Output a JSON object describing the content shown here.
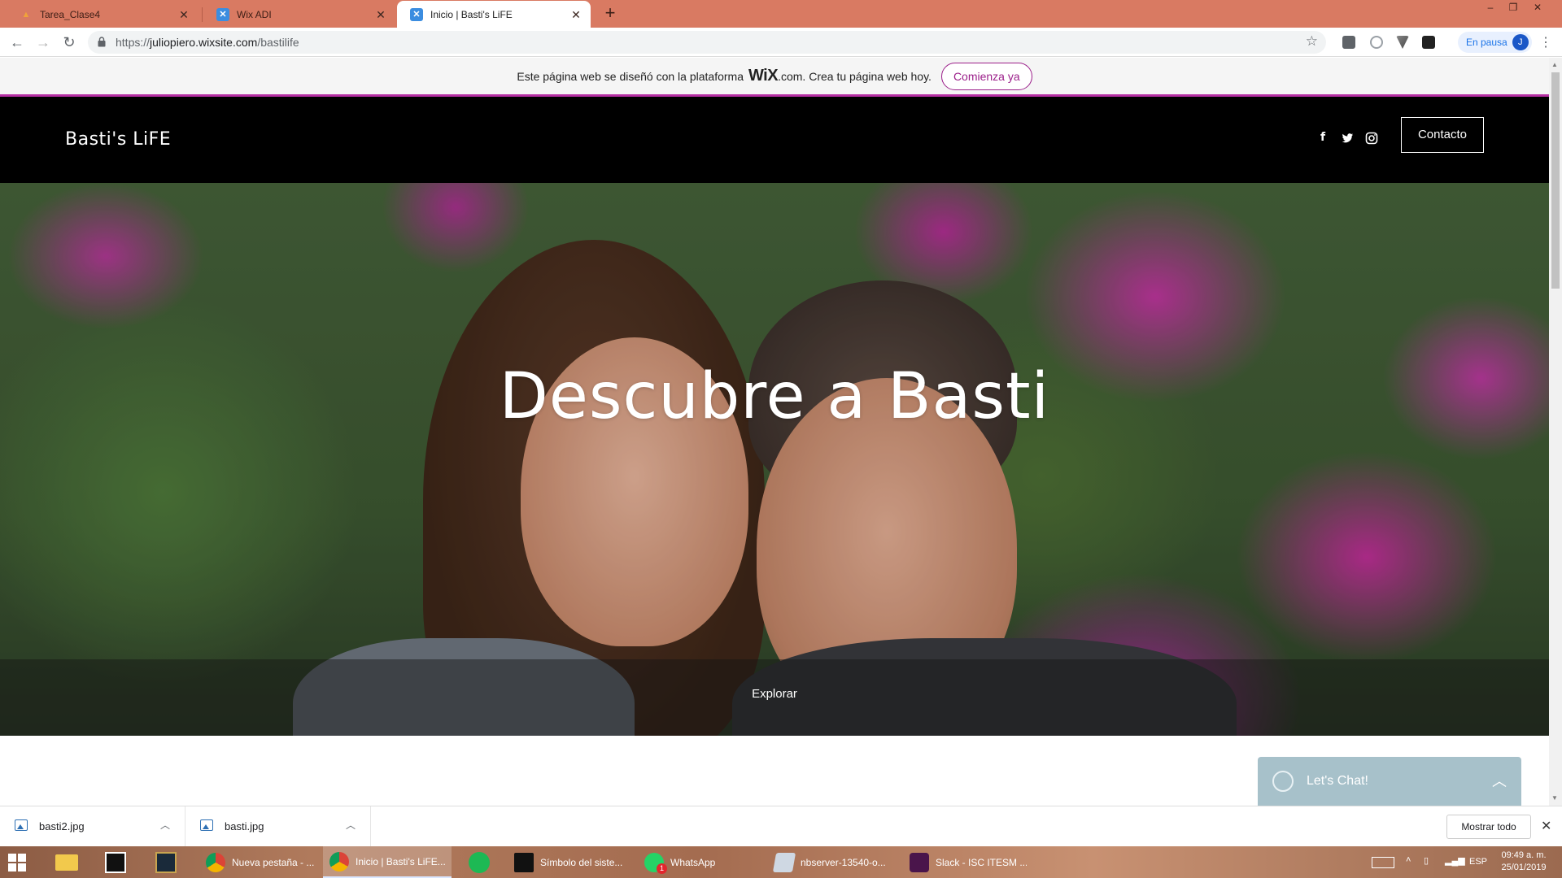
{
  "browser": {
    "tabs": [
      {
        "title": "Tarea_Clase4",
        "active": false
      },
      {
        "title": "Wix ADI",
        "active": false
      },
      {
        "title": "Inicio | Basti's LiFE",
        "active": true
      }
    ],
    "url_prefix": "https://",
    "url_host": "juliopiero.wixsite.com",
    "url_path": "/bastilife",
    "profile_label": "En pausa",
    "profile_initial": "J"
  },
  "wix_banner": {
    "text_before": "Este página web se diseñó con la plataforma",
    "logo": "WiX",
    "text_after": ".com. Crea tu página web hoy.",
    "cta": "Comienza ya"
  },
  "site": {
    "brand": "Basti's LiFE",
    "contact_button": "Contacto",
    "hero_title": "Descubre a Basti",
    "explore_label": "Explorar",
    "accent_color": "#b62fa3"
  },
  "chat": {
    "label": "Let's Chat!"
  },
  "downloads": {
    "items": [
      {
        "name": "basti2.jpg"
      },
      {
        "name": "basti.jpg"
      }
    ],
    "show_all": "Mostrar todo"
  },
  "taskbar": {
    "buttons": [
      {
        "label": "Nueva pestaña - ..."
      },
      {
        "label": "Inicio | Basti's LiFE..."
      },
      {
        "label": "Símbolo del siste..."
      },
      {
        "label": "WhatsApp"
      },
      {
        "label": "nbserver-13540-o..."
      },
      {
        "label": "Slack - ISC ITESM ..."
      }
    ],
    "language": "ESP",
    "time": "09:49 a. m.",
    "date": "25/01/2019",
    "whatsapp_badge": "1"
  }
}
